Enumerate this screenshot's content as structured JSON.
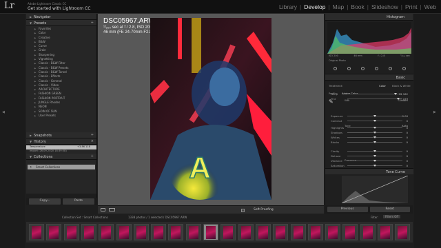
{
  "app": {
    "logo": "Lr",
    "name": "Adobe Lightroom Classic CC",
    "catalog_title": "Get started with Lightroom CC"
  },
  "modules": {
    "items": [
      "Library",
      "Develop",
      "Map",
      "Book",
      "Slideshow",
      "Print",
      "Web"
    ],
    "active": "Develop"
  },
  "left_panel": {
    "navigator_label": "Navigator",
    "presets_label": "Presets",
    "presets": [
      "Favorites",
      "Color",
      "Creative",
      "B&W",
      "Curve",
      "Grain",
      "Sharpening",
      "Vignetting",
      "Classic - B&W Filter",
      "Classic - B&W Presets",
      "Classic - B&W Toned",
      "Classic - Effects",
      "Classic - General",
      "Classic - Video",
      "ARCHITECTURE",
      "FASHION GREEN",
      "FASHION PORTRAIT",
      "JUNGLE Rhodes",
      "NEON",
      "SOIN OF SUN",
      "User Presets"
    ],
    "snapshots_label": "Snapshots",
    "history_label": "History",
    "history": [
      {
        "name": "Temperature",
        "v1": "+3.86",
        "v2": "118"
      },
      {
        "name": "Import (26.09.2020 18:39:58)",
        "v1": "",
        "v2": ""
      }
    ],
    "collections_label": "Collections",
    "collections": [
      "Smart Collections"
    ],
    "copy_label": "Copy...",
    "paste_label": "Paste"
  },
  "photo": {
    "filename": "DSC05967.ARW",
    "exposure": "¹/₂₀₀ sec at f / 2.8, ISO 200",
    "lens": "46 mm (FE 24-70mm F2.8 GM)"
  },
  "toolbar": {
    "soft_proofing_label": "Soft Proofing"
  },
  "right_panel": {
    "histogram_label": "Histogram",
    "exif": [
      "ISO 200",
      "46 mm",
      "f / 2.8",
      "¹/₂₀₀ sec"
    ],
    "original_photo_label": "Original Photo",
    "basic_label": "Basic",
    "treatment_label": "Treatment:",
    "treatment_color": "Color",
    "treatment_bw": "Black & White",
    "profile_label": "Profile:",
    "profile_value": "Adobe Color",
    "wb_label": "WB:",
    "wb_value": "Custom",
    "sliders": [
      {
        "label": "Temp",
        "value": "15 182",
        "pos": 0.88
      },
      {
        "label": "Tint",
        "value": "+ 159",
        "pos": 0.92
      },
      {
        "label": "Exposure",
        "value": "0.00",
        "pos": 0.5
      },
      {
        "label": "Contrast",
        "value": "0",
        "pos": 0.5
      },
      {
        "label": "Highlights",
        "value": "0",
        "pos": 0.5
      },
      {
        "label": "Shadows",
        "value": "0",
        "pos": 0.5
      },
      {
        "label": "Whites",
        "value": "0",
        "pos": 0.5
      },
      {
        "label": "Blacks",
        "value": "0",
        "pos": 0.5
      },
      {
        "label": "Clarity",
        "value": "0",
        "pos": 0.5
      },
      {
        "label": "Dehaze",
        "value": "0",
        "pos": 0.5
      },
      {
        "label": "Vibrance",
        "value": "0",
        "pos": 0.5
      },
      {
        "label": "Saturation",
        "value": "0",
        "pos": 0.5
      }
    ],
    "tone_label": "Tone",
    "tone_auto": "Auto",
    "presence_label": "Presence",
    "tone_curve_label": "Tone Curve",
    "previous_label": "Previous",
    "reset_label": "Reset"
  },
  "filmstrip": {
    "source": "Collection Set : Smart Collections",
    "count": "1338 photos / 1 selected / DSC05967.ARW",
    "filter_label": "Filter:",
    "filter_value": "Filters Off",
    "thumb_count": 22,
    "selected_index": 10
  },
  "colors": {
    "accent_active": "#e8e8e8",
    "panel_bg": "#1d1d1d",
    "neon_red": "#ff1e3c",
    "neon_yellow": "#e6e23a"
  }
}
